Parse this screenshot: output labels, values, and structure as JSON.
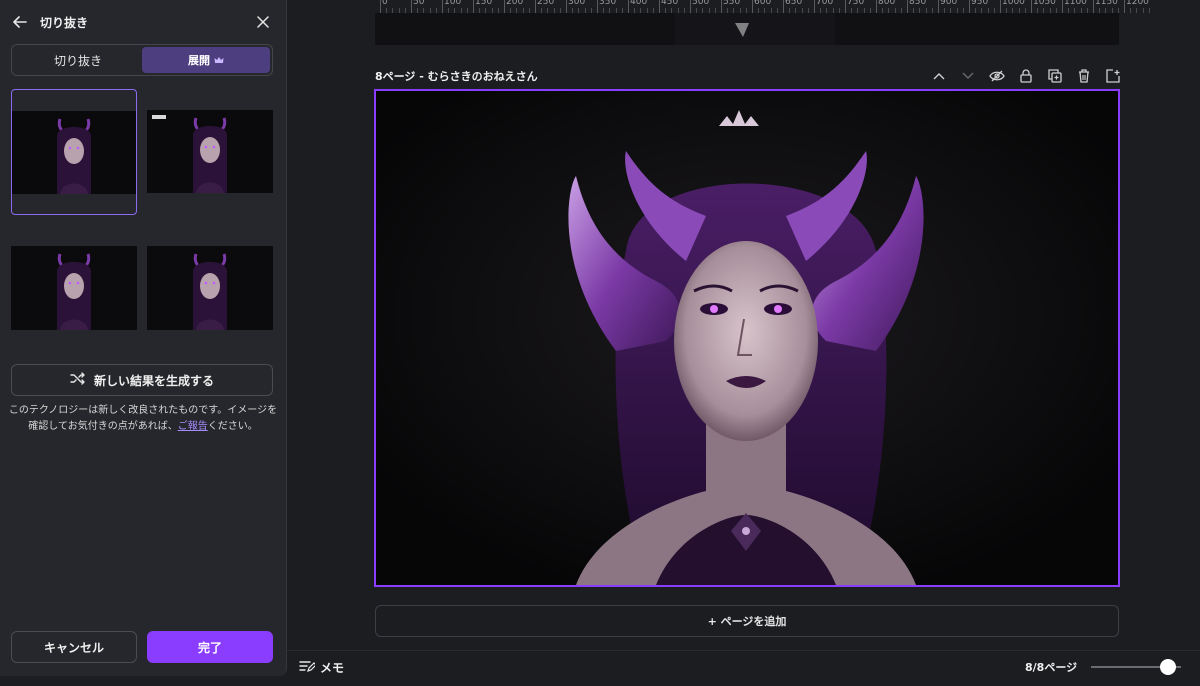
{
  "panel": {
    "title": "切り抜き",
    "tabs": [
      {
        "label": "切り抜き"
      },
      {
        "label": "展開"
      }
    ],
    "generate_label": "新しい結果を生成する",
    "notice_text_1": "このテクノロジーは新しく改良されたものです。イメージを確認してお気付きの点があれば、",
    "notice_link": "ご報告",
    "notice_text_2": "ください。",
    "cancel_label": "キャンセル",
    "done_label": "完了"
  },
  "ruler": {
    "labels": [
      "0",
      "50",
      "100",
      "150",
      "200",
      "250",
      "300",
      "350",
      "400",
      "450",
      "500",
      "550",
      "600",
      "650",
      "700",
      "750",
      "800",
      "850",
      "900",
      "950",
      "1000",
      "1050",
      "1100",
      "1150",
      "1200"
    ]
  },
  "page": {
    "label": "8ページ - むらさきのおねえさん"
  },
  "add_page_label": "+ ページを追加",
  "bottom": {
    "memo_label": "メモ",
    "page_count": "8/8ページ",
    "zoom_fraction": 0.85
  },
  "colors": {
    "accent": "#8b3dff",
    "selected_tab": "#4d3f7f",
    "link": "#a88cff",
    "panel_bg": "#25272c",
    "app_bg": "#1b1d21"
  }
}
